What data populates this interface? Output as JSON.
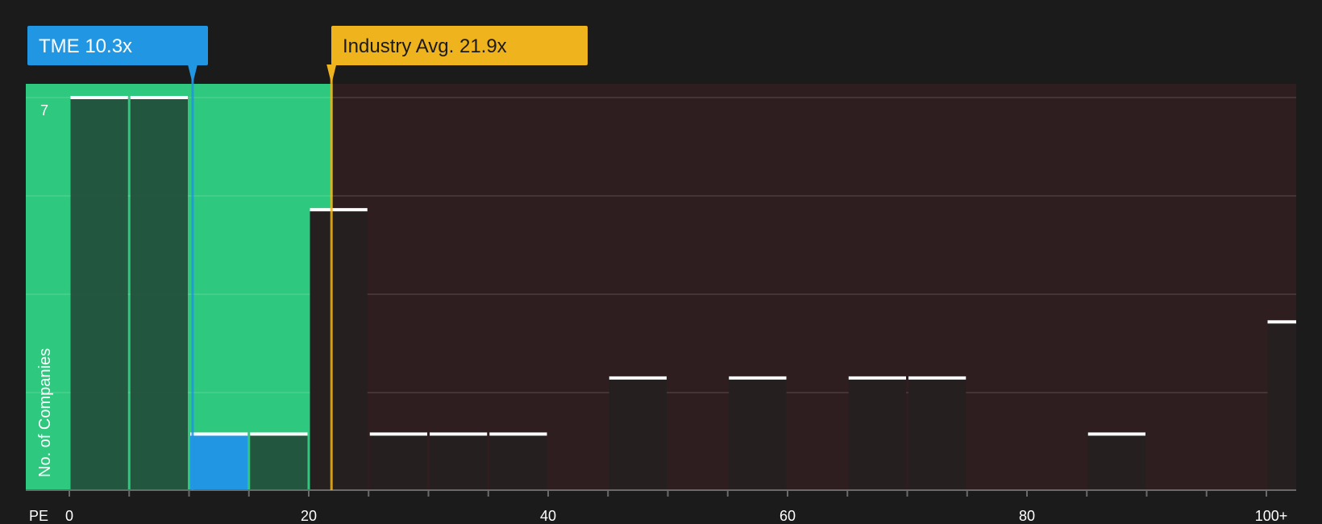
{
  "chart_data": {
    "type": "bar",
    "xlabel": "PE",
    "ylabel": "No. of Companies",
    "x_ticks": [
      "0",
      "20",
      "40",
      "60",
      "80",
      "100+"
    ],
    "y_tick_labels": [
      "7"
    ],
    "bin_width": 5,
    "ylim": [
      0,
      7
    ],
    "bins": [
      {
        "x_start": 0,
        "value": 7
      },
      {
        "x_start": 5,
        "value": 7
      },
      {
        "x_start": 10,
        "value": 1,
        "highlight": true
      },
      {
        "x_start": 15,
        "value": 1
      },
      {
        "x_start": 20,
        "value": 5
      },
      {
        "x_start": 25,
        "value": 1
      },
      {
        "x_start": 30,
        "value": 1
      },
      {
        "x_start": 35,
        "value": 1
      },
      {
        "x_start": 45,
        "value": 2
      },
      {
        "x_start": 55,
        "value": 2
      },
      {
        "x_start": 65,
        "value": 2
      },
      {
        "x_start": 70,
        "value": 2
      },
      {
        "x_start": 85,
        "value": 1
      },
      {
        "x_start": 100,
        "value": 3
      }
    ],
    "company_marker": {
      "label": "TME 10.3x",
      "value": 10.3
    },
    "industry_marker": {
      "label": "Industry Avg. 21.9x",
      "value": 21.9
    },
    "shaded_zone_end": 22
  },
  "colors": {
    "background": "#1b1b1b",
    "green_zone": "#2ec97f",
    "red_zone": "#2e1e1f",
    "company": "#2196e3",
    "industry": "#efb41d",
    "bar_in_green": "#234c38",
    "bar_in_red": "#251f1f",
    "cap": "#ffffff"
  }
}
